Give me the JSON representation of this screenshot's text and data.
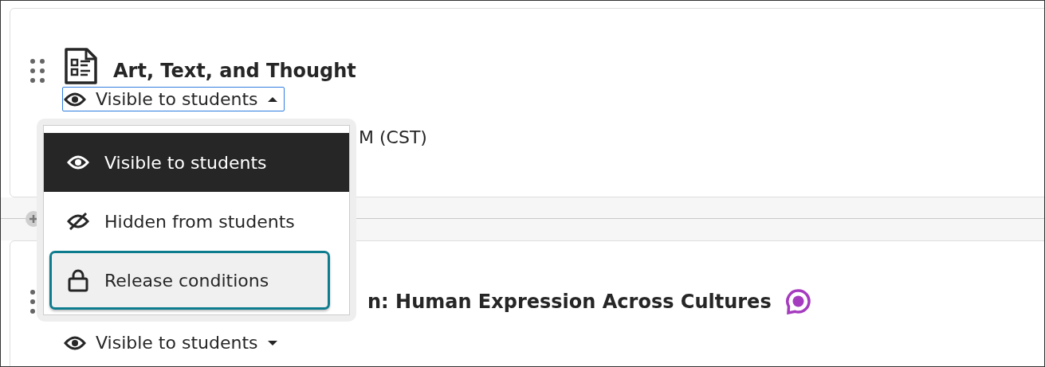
{
  "items": [
    {
      "kind": "document",
      "title": "Art, Text, and Thought",
      "visibility": {
        "label": "Visible to students",
        "expanded": true
      },
      "date_text": "M (CST)"
    },
    {
      "kind": "discussion",
      "title": "n: Human Expression Across Cultures",
      "visibility": {
        "label": "Visible to students",
        "expanded": false
      }
    }
  ],
  "visibility_menu": {
    "options": [
      {
        "kind": "visible",
        "label": "Visible to students",
        "selected": true,
        "focused": false
      },
      {
        "kind": "hidden",
        "label": "Hidden from students",
        "selected": false,
        "focused": false
      },
      {
        "kind": "release",
        "label": "Release conditions",
        "selected": false,
        "focused": true
      }
    ]
  }
}
